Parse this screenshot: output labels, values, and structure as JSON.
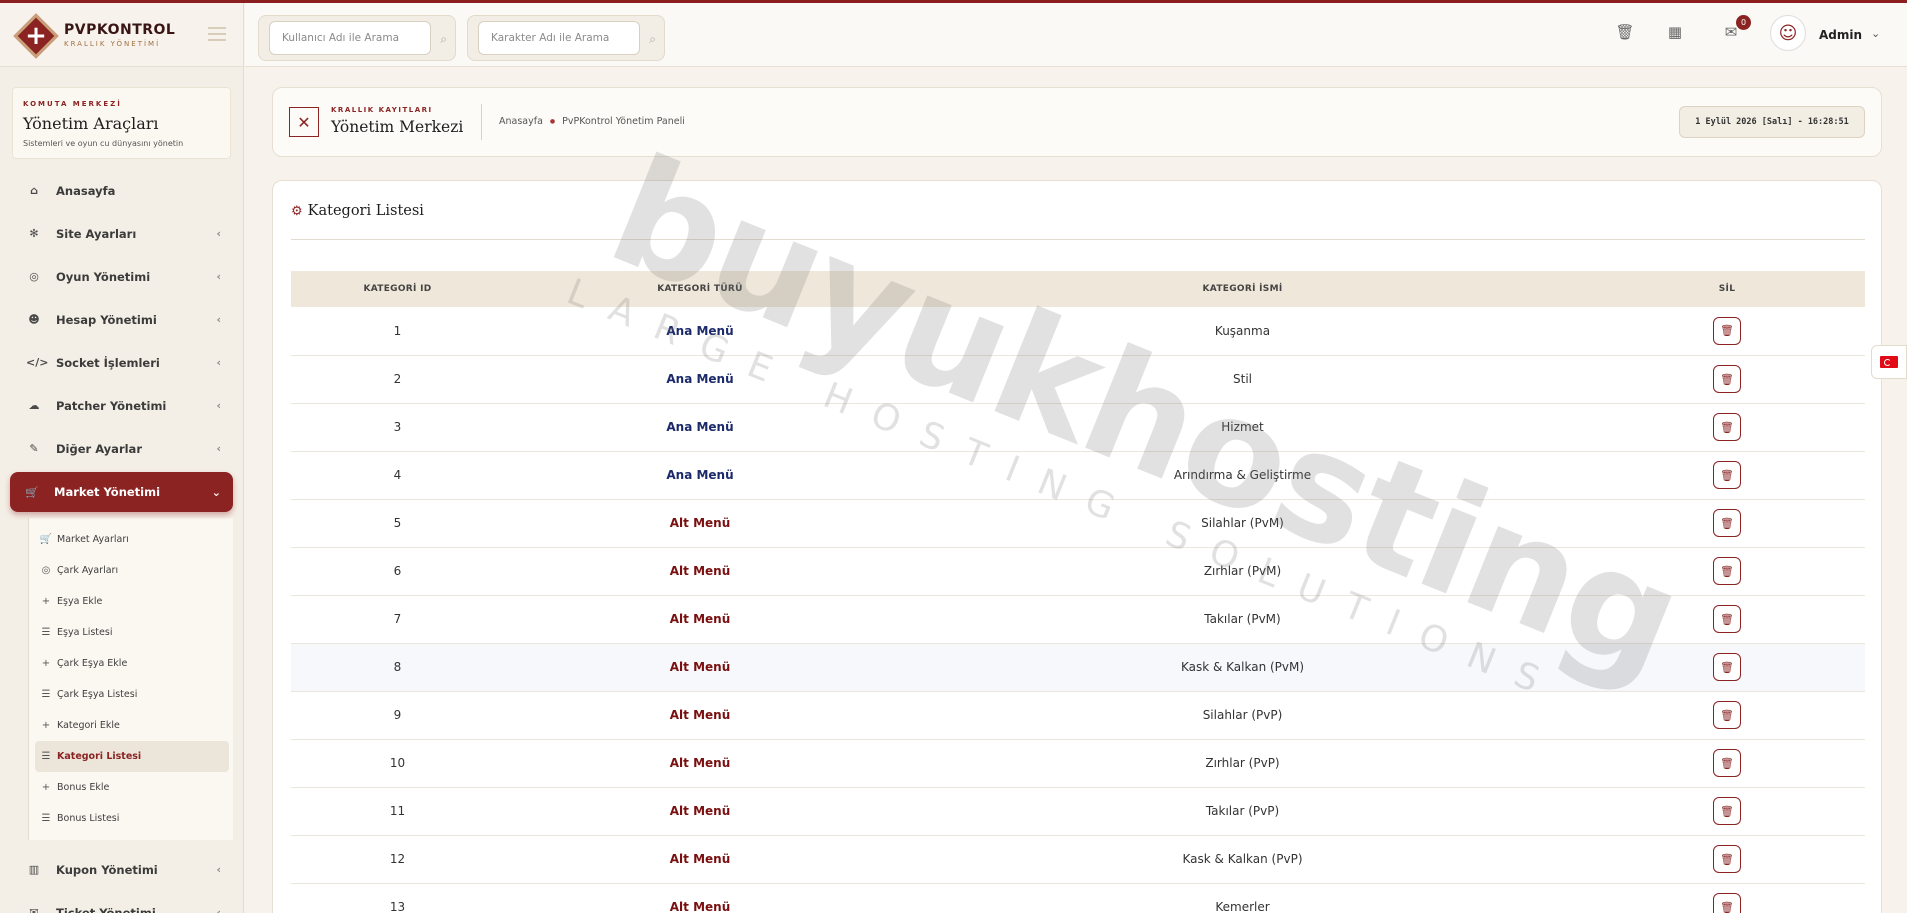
{
  "brand": {
    "title": "PVPKONTROL",
    "subtitle": "KRALLIK YÖNETİMİ"
  },
  "panel": {
    "eyebrow": "KOMUTA MERKEZİ",
    "title": "Yönetim Araçları",
    "desc": "Sistemleri ve oyun cu dünyasını yönetin"
  },
  "nav": [
    {
      "label": "Anasayfa",
      "icon": "home-icon",
      "glyph": "⌂",
      "chevron": false
    },
    {
      "label": "Site Ayarları",
      "icon": "gear-icon",
      "glyph": "✻",
      "chevron": true
    },
    {
      "label": "Oyun Yönetimi",
      "icon": "gamepad-icon",
      "glyph": "◎",
      "chevron": true
    },
    {
      "label": "Hesap Yönetimi",
      "icon": "users-icon",
      "glyph": "☻",
      "chevron": true
    },
    {
      "label": "Socket İşlemleri",
      "icon": "code-icon",
      "glyph": "</>",
      "chevron": true
    },
    {
      "label": "Patcher Yönetimi",
      "icon": "cloud-upload-icon",
      "glyph": "☁",
      "chevron": true
    },
    {
      "label": "Diğer Ayarlar",
      "icon": "wrench-icon",
      "glyph": "✎",
      "chevron": true
    }
  ],
  "nav_active": {
    "label": "Market Yönetimi",
    "glyph": "🛒"
  },
  "submenu": [
    {
      "label": "Market Ayarları",
      "icon": "cart-icon",
      "glyph": "🛒"
    },
    {
      "label": "Çark Ayarları",
      "icon": "gamepad-icon",
      "glyph": "◎"
    },
    {
      "label": "Eşya Ekle",
      "icon": "plus-icon",
      "glyph": "+"
    },
    {
      "label": "Eşya Listesi",
      "icon": "list-icon",
      "glyph": "☰"
    },
    {
      "label": "Çark Eşya Ekle",
      "icon": "plus-icon",
      "glyph": "+"
    },
    {
      "label": "Çark Eşya Listesi",
      "icon": "list-icon",
      "glyph": "☰"
    },
    {
      "label": "Kategori Ekle",
      "icon": "plus-icon",
      "glyph": "+"
    },
    {
      "label": "Kategori Listesi",
      "icon": "list-icon",
      "glyph": "☰"
    },
    {
      "label": "Bonus Ekle",
      "icon": "plus-icon",
      "glyph": "+"
    },
    {
      "label": "Bonus Listesi",
      "icon": "list-icon",
      "glyph": "☰"
    }
  ],
  "nav_bottom": [
    {
      "label": "Kupon Yönetimi",
      "icon": "barcode-icon",
      "glyph": "▥"
    },
    {
      "label": "Ticket Yönetimi",
      "icon": "ticket-icon",
      "glyph": "✉"
    }
  ],
  "search": {
    "user_placeholder": "Kullanıcı Adı ile Arama",
    "char_placeholder": "Karakter Adı ile Arama"
  },
  "topbar": {
    "notification_count": "0",
    "user_name": "Admin"
  },
  "header": {
    "eyebrow": "KRALLIK KAYITLARI",
    "title": "Yönetim Merkezi",
    "breadcrumb_home": "Anasayfa",
    "breadcrumb_current": "PvPKontrol Yönetim Paneli",
    "datetime": "1 Eylül 2026 [Salı] - 16:28:51"
  },
  "card": {
    "title": "Kategori Listesi"
  },
  "table": {
    "columns": [
      "KATEGORİ ID",
      "KATEGORİ TÜRÜ",
      "KATEGORİ İSMİ",
      "SİL"
    ],
    "rows": [
      {
        "id": "1",
        "type": "Ana Menü",
        "name": "Kuşanma"
      },
      {
        "id": "2",
        "type": "Ana Menü",
        "name": "Stil"
      },
      {
        "id": "3",
        "type": "Ana Menü",
        "name": "Hizmet"
      },
      {
        "id": "4",
        "type": "Ana Menü",
        "name": "Arındırma & Geliştirme"
      },
      {
        "id": "5",
        "type": "Alt Menü",
        "name": "Silahlar (PvM)"
      },
      {
        "id": "6",
        "type": "Alt Menü",
        "name": "Zırhlar (PvM)"
      },
      {
        "id": "7",
        "type": "Alt Menü",
        "name": "Takılar (PvM)"
      },
      {
        "id": "8",
        "type": "Alt Menü",
        "name": "Kask & Kalkan (PvM)"
      },
      {
        "id": "9",
        "type": "Alt Menü",
        "name": "Silahlar (PvP)"
      },
      {
        "id": "10",
        "type": "Alt Menü",
        "name": "Zırhlar (PvP)"
      },
      {
        "id": "11",
        "type": "Alt Menü",
        "name": "Takılar (PvP)"
      },
      {
        "id": "12",
        "type": "Alt Menü",
        "name": "Kask & Kalkan (PvP)"
      },
      {
        "id": "13",
        "type": "Alt Menü",
        "name": "Kemerler"
      }
    ]
  },
  "watermark": {
    "main": "buyukhosting",
    "sub": "LARGE HOSTING SOLUTIONS"
  }
}
